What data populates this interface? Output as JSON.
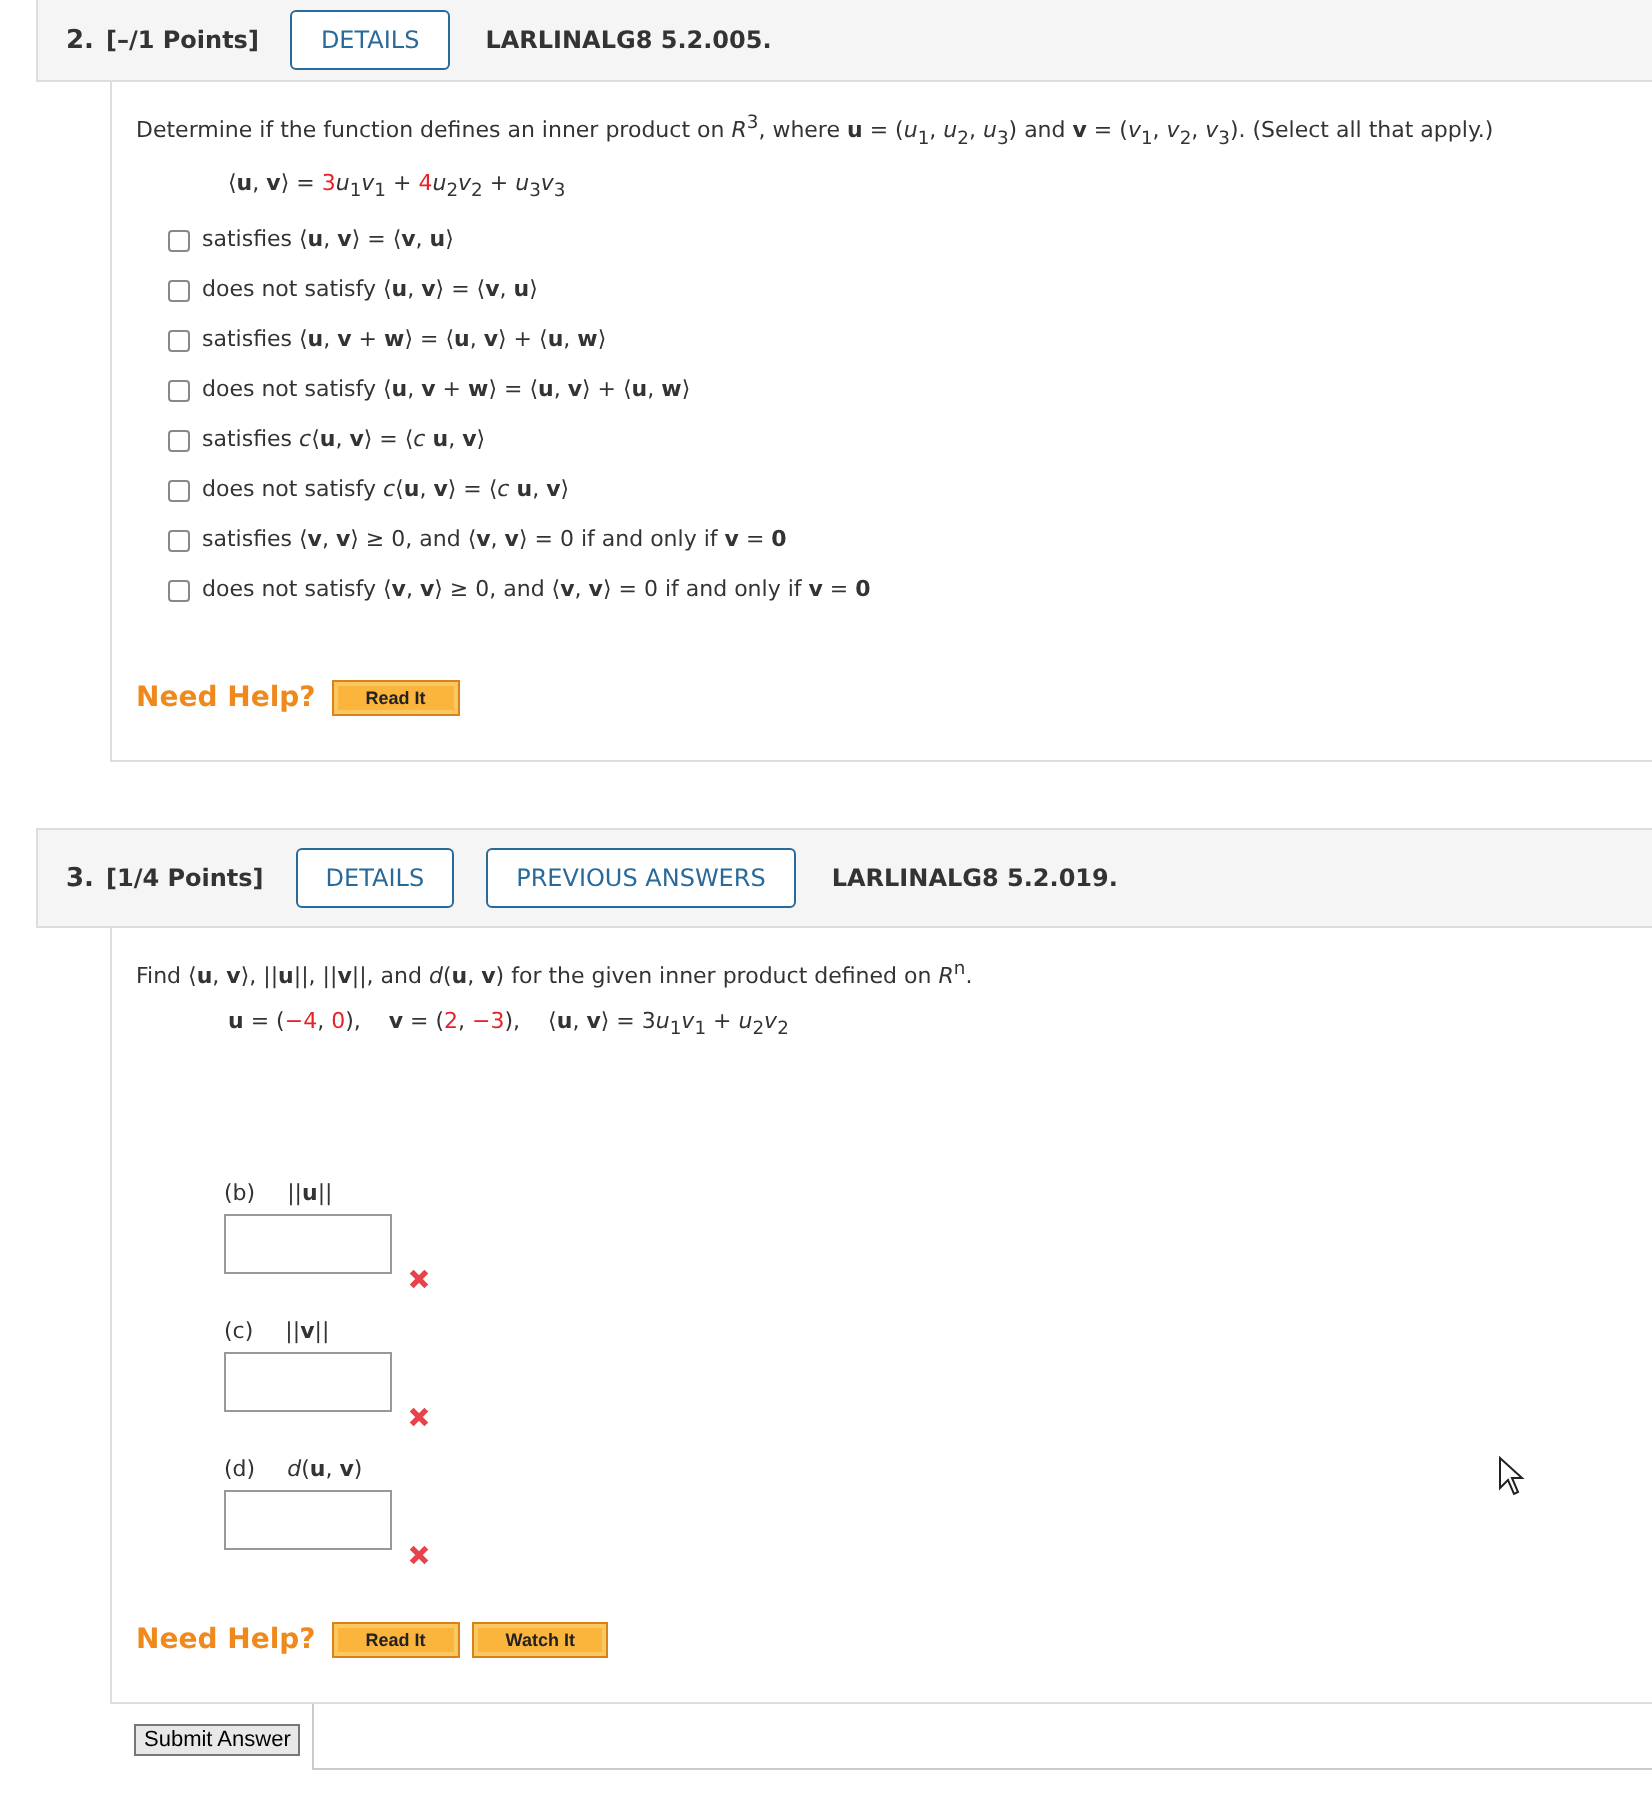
{
  "questions": [
    {
      "number": "2.",
      "points": "[–/1 Points]",
      "buttons": [
        "DETAILS"
      ],
      "code": "LARLINALG8 5.2.005.",
      "prompt": "Determine if the function defines an inner product on *R*$^{3}$, where **u** = (*u*$_{1}$, *u*$_{2}$, *u*$_{3}$) and **v** = (*v*$_{1}$, *v*$_{2}$, *v*$_{3}$). (Select all that apply.)",
      "formula": [
        {
          "text": "⟨**u**, **v**⟩ = ",
          "highlight": false
        },
        {
          "text": "3",
          "highlight": true
        },
        {
          "text": "*u*$_{1}$*v*$_{1}$ + ",
          "highlight": false
        },
        {
          "text": "4",
          "highlight": true
        },
        {
          "text": "*u*$_{2}$*v*$_{2}$ + *u*$_{3}$*v*$_{3}$",
          "highlight": false
        }
      ],
      "options": [
        {
          "text": "satisfies ⟨**u**, **v**⟩ = ⟨**v**, **u**⟩",
          "checked": false
        },
        {
          "text": "does not satisfy ⟨**u**, **v**⟩ = ⟨**v**, **u**⟩",
          "checked": false
        },
        {
          "text": "satisfies ⟨**u**, **v** + **w**⟩ = ⟨**u**, **v**⟩ + ⟨**u**, **w**⟩",
          "checked": false
        },
        {
          "text": "does not satisfy ⟨**u**, **v** + **w**⟩ = ⟨**u**, **v**⟩ + ⟨**u**, **w**⟩",
          "checked": false
        },
        {
          "text": "satisfies *c*⟨**u**, **v**⟩ = ⟨*c* **u**, **v**⟩",
          "checked": false
        },
        {
          "text": "does not satisfy *c*⟨**u**, **v**⟩ = ⟨*c* **u**, **v**⟩",
          "checked": false
        },
        {
          "text": "satisfies ⟨**v**, **v**⟩ ≥ 0, and ⟨**v**, **v**⟩ = 0 if and only if **v** = **0**",
          "checked": false
        },
        {
          "text": "does not satisfy ⟨**v**, **v**⟩ ≥ 0, and ⟨**v**, **v**⟩ = 0 if and only if **v** = **0**",
          "checked": false
        }
      ],
      "help": {
        "label": "Need Help?",
        "buttons": [
          "Read It"
        ]
      }
    },
    {
      "number": "3.",
      "points": "[1/4 Points]",
      "buttons": [
        "DETAILS",
        "PREVIOUS ANSWERS"
      ],
      "code": "LARLINALG8 5.2.019.",
      "prompt": "Find ⟨**u**, **v**⟩, ||**u**||, ||**v**||, and *d*(**u**, **v**) for the given inner product defined on *R*$^{n}$.",
      "formula": [
        {
          "text": "**u** = (",
          "highlight": false
        },
        {
          "text": "−4",
          "highlight": true
        },
        {
          "text": ", ",
          "highlight": false
        },
        {
          "text": "0",
          "highlight": true
        },
        {
          "text": "),    **v** = (",
          "highlight": false
        },
        {
          "text": "2",
          "highlight": true
        },
        {
          "text": ", ",
          "highlight": false
        },
        {
          "text": "−3",
          "highlight": true
        },
        {
          "text": "),    ⟨**u**, **v**⟩ = 3",
          "highlight": false
        },
        {
          "text": "*u*$_{1}$*v*$_{1}$ + *u*$_{2}$*v*$_{2}$",
          "highlight": false
        }
      ],
      "parts": [
        {
          "label": "(b)",
          "expr": "||**u**||",
          "correct": false
        },
        {
          "label": "(c)",
          "expr": "||**v**||",
          "correct": false
        },
        {
          "label": "(d)",
          "expr": "*d*(**u**, **v**)",
          "correct": false
        }
      ],
      "help": {
        "label": "Need Help?",
        "buttons": [
          "Read It",
          "Watch It"
        ]
      },
      "submit": "Submit Answer"
    }
  ]
}
